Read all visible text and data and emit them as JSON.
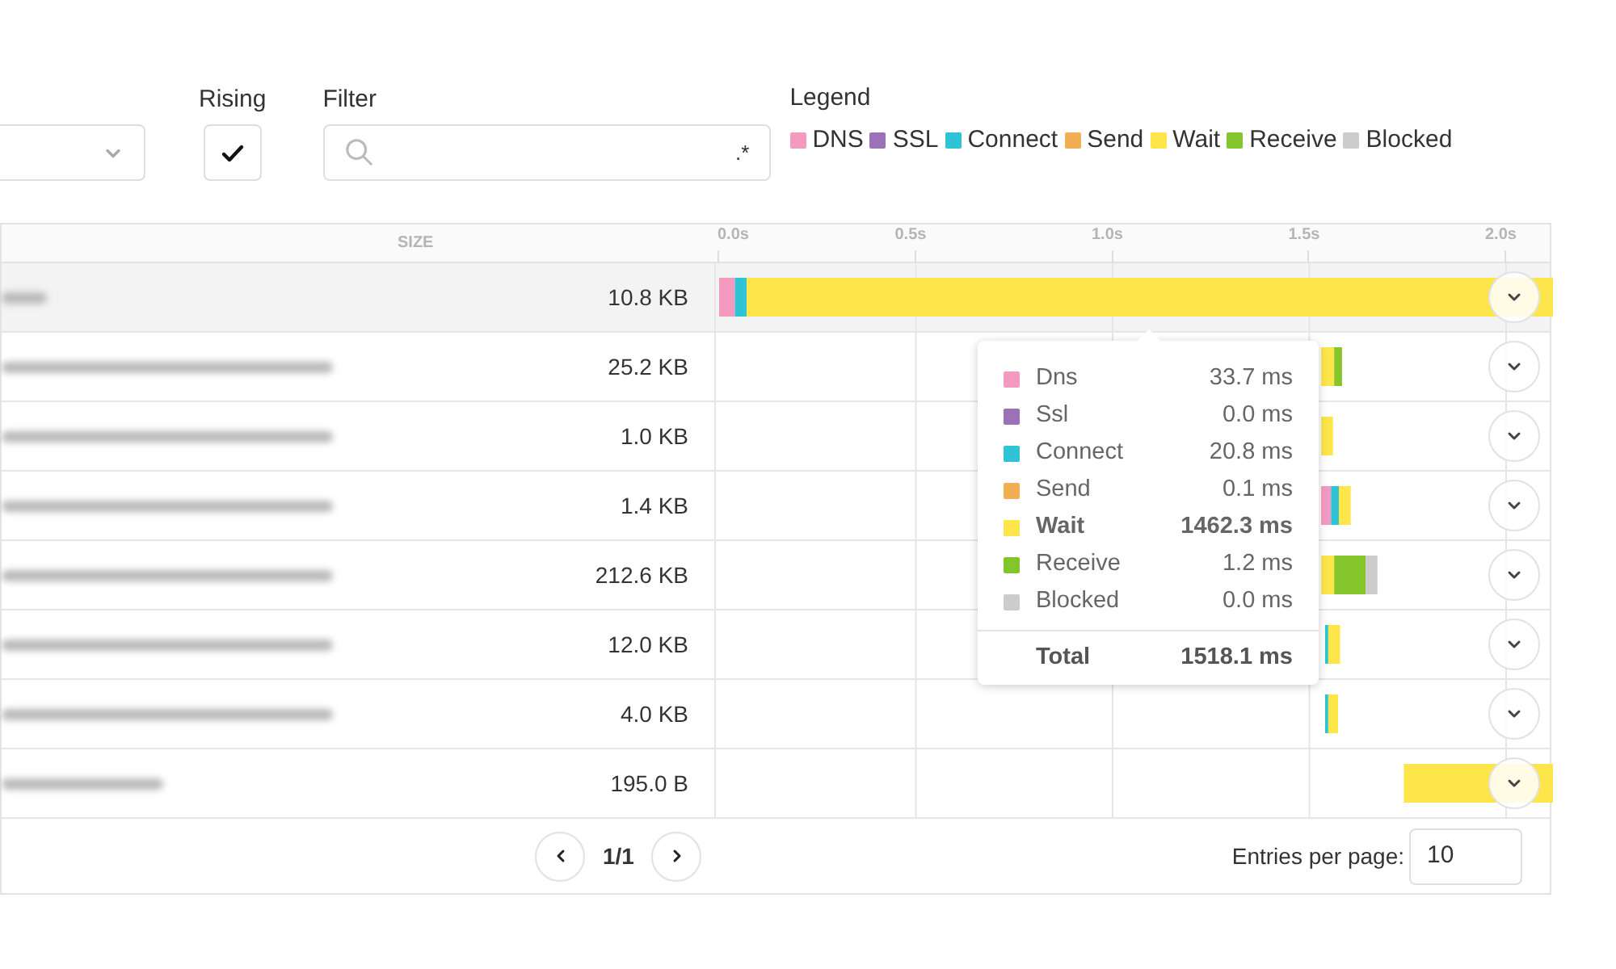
{
  "rising": {
    "label": "Rising",
    "checked": true
  },
  "filter": {
    "label": "Filter",
    "regex_toggle": ".*"
  },
  "legend": {
    "label": "Legend",
    "items": [
      {
        "label": "DNS",
        "color": "#f49ac1"
      },
      {
        "label": "SSL",
        "color": "#9b72b8"
      },
      {
        "label": "Connect",
        "color": "#2ec4d6"
      },
      {
        "label": "Send",
        "color": "#f2ae52"
      },
      {
        "label": "Wait",
        "color": "#fde54a"
      },
      {
        "label": "Receive",
        "color": "#84c52b"
      },
      {
        "label": "Blocked",
        "color": "#cccccc"
      }
    ]
  },
  "table": {
    "columns": [
      {
        "label": "SIZE"
      }
    ],
    "rows": [
      {
        "size": "10.8 KB",
        "selected": true
      },
      {
        "size": "25.2 KB",
        "selected": false
      },
      {
        "size": "1.0 KB",
        "selected": false
      },
      {
        "size": "1.4 KB",
        "selected": false
      },
      {
        "size": "212.6 KB",
        "selected": false
      },
      {
        "size": "12.0 KB",
        "selected": false
      },
      {
        "size": "4.0 KB",
        "selected": false
      },
      {
        "size": "195.0 B",
        "selected": false
      }
    ],
    "timeline_ticks": [
      "0.0s",
      "0.5s",
      "1.0s",
      "1.5s",
      "2.0s"
    ]
  },
  "tooltip": {
    "rows": [
      {
        "label": "Dns",
        "value": "33.7 ms",
        "color": "#f49ac1",
        "bold": false
      },
      {
        "label": "Ssl",
        "value": "0.0 ms",
        "color": "#9b72b8",
        "bold": false
      },
      {
        "label": "Connect",
        "value": "20.8 ms",
        "color": "#2ec4d6",
        "bold": false
      },
      {
        "label": "Send",
        "value": "0.1 ms",
        "color": "#f2ae52",
        "bold": false
      },
      {
        "label": "Wait",
        "value": "1462.3 ms",
        "color": "#fde54a",
        "bold": true
      },
      {
        "label": "Receive",
        "value": "1.2 ms",
        "color": "#84c52b",
        "bold": false
      },
      {
        "label": "Blocked",
        "value": "0.0 ms",
        "color": "#cccccc",
        "bold": false
      }
    ],
    "total": {
      "label": "Total",
      "value": "1518.1 ms"
    }
  },
  "pagination": {
    "page": "1/1",
    "entries_label": "Entries per page:",
    "entries_value": "10"
  }
}
